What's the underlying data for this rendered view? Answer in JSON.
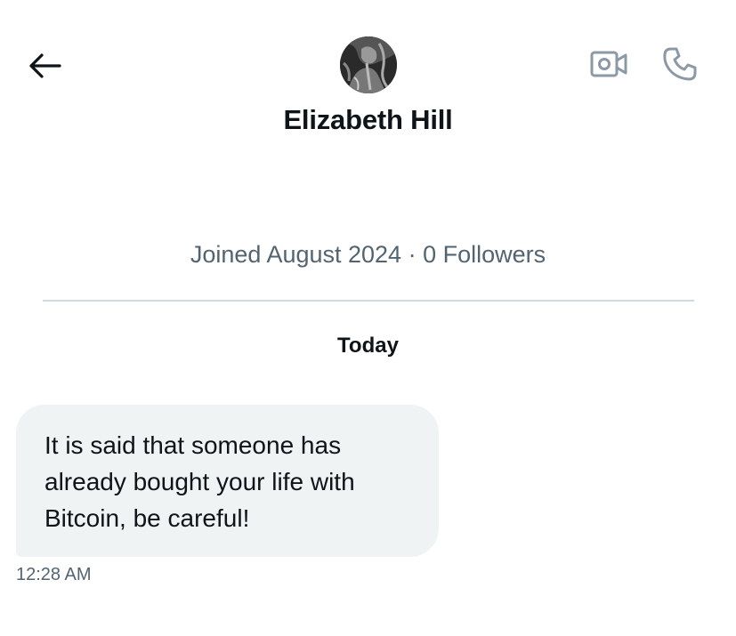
{
  "header": {
    "back_icon": "arrow-left-icon",
    "contact_name": "Elizabeth Hill",
    "video_icon": "video-camera-icon",
    "call_icon": "phone-icon"
  },
  "profile": {
    "meta": "Joined August 2024 · 0 Followers"
  },
  "conversation": {
    "day_label": "Today",
    "messages": [
      {
        "text": "It is said that someone has already bought your life with Bitcoin, be careful!",
        "time": "12:28 AM",
        "direction": "incoming"
      }
    ]
  },
  "colors": {
    "text_primary": "#0f1419",
    "text_secondary": "#536471",
    "bubble_bg": "#eff3f4",
    "divider": "#cfd9de",
    "icon_muted": "#8b98a5"
  }
}
